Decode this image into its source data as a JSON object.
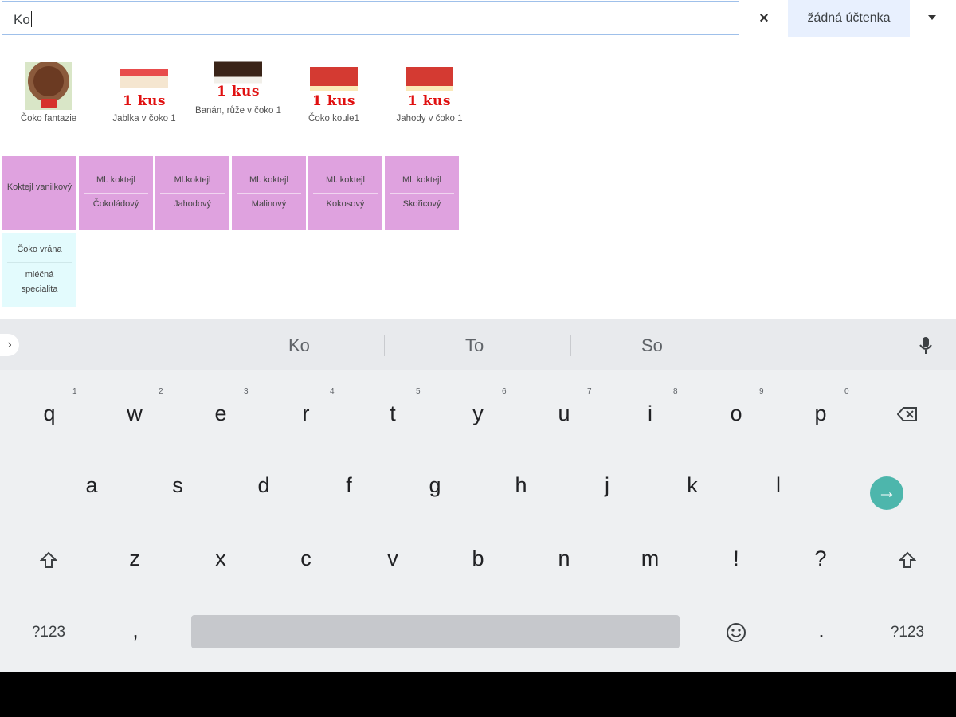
{
  "search": {
    "value": "Ko"
  },
  "toolbar": {
    "clear_label": "×",
    "receipt_label": "žádná účtenka"
  },
  "products": [
    {
      "name": "Čoko fantazie",
      "badge": ""
    },
    {
      "name": "Jablka v čoko 1",
      "badge": "1 kus"
    },
    {
      "name": "Banán, růže v čoko 1",
      "badge": "1 kus"
    },
    {
      "name": "Čoko koule1",
      "badge": "1 kus"
    },
    {
      "name": "Jahody v čoko 1",
      "badge": "1 kus"
    }
  ],
  "categories": [
    {
      "line1": "Koktejl vanilkový",
      "line2": ""
    },
    {
      "line1": "Ml. koktejl",
      "line2": "Čokoládový"
    },
    {
      "line1": "Ml.koktejl",
      "line2": "Jahodový"
    },
    {
      "line1": "Ml. koktejl",
      "line2": "Malinový"
    },
    {
      "line1": "Ml. koktejl",
      "line2": "Kokosový"
    },
    {
      "line1": "Ml. koktejl",
      "line2": "Skořicový"
    },
    {
      "line1": "Čoko vrána",
      "line2": "mléčná specialita"
    }
  ],
  "keyboard": {
    "suggestions": [
      "Ko",
      "To",
      "So"
    ],
    "row1": [
      "q",
      "w",
      "e",
      "r",
      "t",
      "y",
      "u",
      "i",
      "o",
      "p"
    ],
    "row1_numbers": [
      "1",
      "2",
      "3",
      "4",
      "5",
      "6",
      "7",
      "8",
      "9",
      "0"
    ],
    "row2": [
      "a",
      "s",
      "d",
      "f",
      "g",
      "h",
      "j",
      "k",
      "l"
    ],
    "row3": [
      "z",
      "x",
      "c",
      "v",
      "b",
      "n",
      "m",
      "!",
      "?"
    ],
    "symbols_label": "?123",
    "comma": ",",
    "period": "."
  },
  "colors": {
    "pink_tile": "#dfa2df",
    "cyan_tile": "#e3fbfd",
    "enter_key": "#4db6ac"
  }
}
